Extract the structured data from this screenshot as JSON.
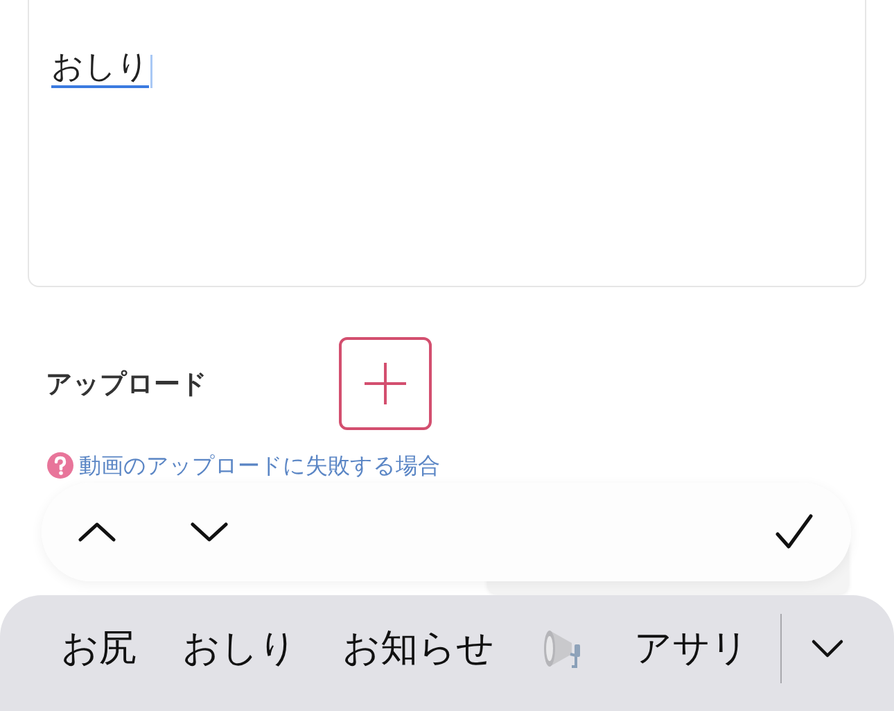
{
  "editor": {
    "value": "おしり",
    "composing": true
  },
  "upload": {
    "label": "アップロード"
  },
  "help_link": {
    "text": "動画のアップロードに失敗する場合"
  },
  "input_toolbar": {
    "buttons": [
      {
        "kind": "up"
      },
      {
        "kind": "down"
      },
      {
        "kind": "done"
      }
    ]
  },
  "suggestions": [
    {
      "kind": "text",
      "text": "お尻"
    },
    {
      "kind": "text",
      "text": "おしり"
    },
    {
      "kind": "text",
      "text": "お知らせ"
    },
    {
      "kind": "emoji"
    },
    {
      "kind": "text",
      "text": "アサリ"
    }
  ]
}
